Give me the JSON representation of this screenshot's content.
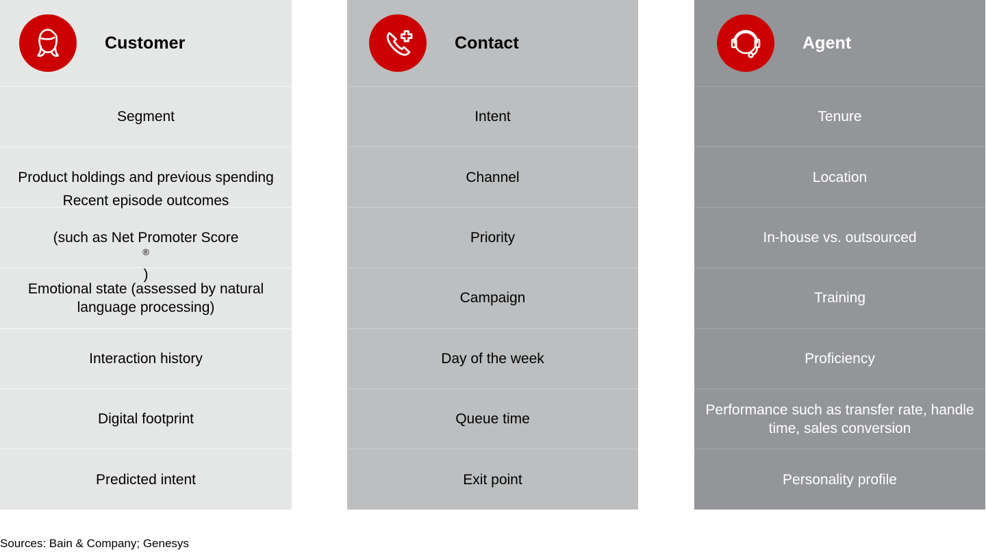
{
  "colors": {
    "brand_red": "#cc0000",
    "customer_bg": "#e5e7e6",
    "contact_bg": "#bcbec0",
    "agent_bg": "#939598",
    "page_bg": "#ffffff"
  },
  "columns": [
    {
      "id": "customer",
      "title": "Customer",
      "icon": "customer-head-icon",
      "rows": [
        {
          "text": "Segment"
        },
        {
          "text": "Product holdings and previous spending"
        },
        {
          "text": "Recent episode outcomes (such as Net Promoter Score®)",
          "line1": "Recent episode outcomes",
          "line2_pre": "(such as Net Promoter Score",
          "line2_sup": "®",
          "line2_post": ")"
        },
        {
          "text": "Emotional state (assessed by natural language processing)"
        },
        {
          "text": "Interaction history"
        },
        {
          "text": "Digital footprint"
        },
        {
          "text": "Predicted intent"
        }
      ]
    },
    {
      "id": "contact",
      "title": "Contact",
      "icon": "phone-plus-icon",
      "rows": [
        {
          "text": "Intent"
        },
        {
          "text": "Channel"
        },
        {
          "text": "Priority"
        },
        {
          "text": "Campaign"
        },
        {
          "text": "Day of the week"
        },
        {
          "text": "Queue time"
        },
        {
          "text": "Exit point"
        }
      ]
    },
    {
      "id": "agent",
      "title": "Agent",
      "icon": "headset-icon",
      "rows": [
        {
          "text": "Tenure"
        },
        {
          "text": "Location"
        },
        {
          "text": "In-house vs. outsourced"
        },
        {
          "text": "Training"
        },
        {
          "text": "Proficiency"
        },
        {
          "text": "Performance such as transfer rate, handle time, sales conversion"
        },
        {
          "text": "Personality profile"
        }
      ]
    }
  ],
  "footer": {
    "sources": "Sources: Bain & Company; Genesys"
  }
}
